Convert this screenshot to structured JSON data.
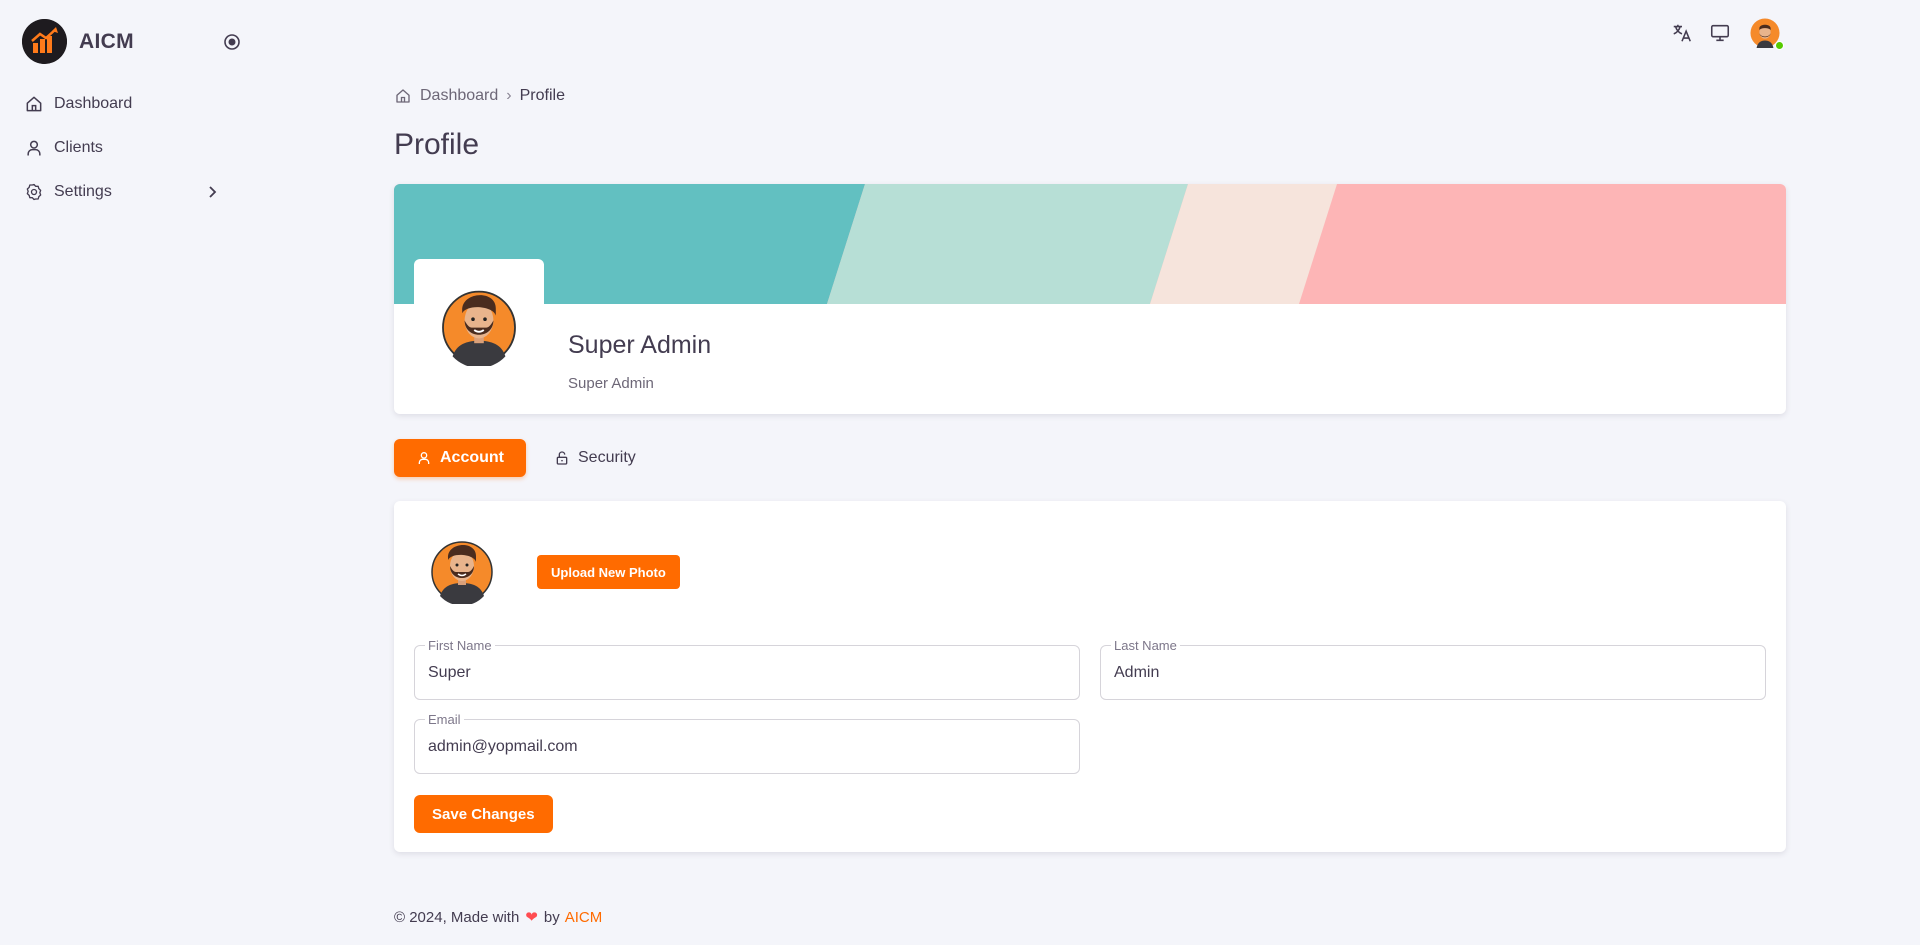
{
  "brand": {
    "name": "AICM"
  },
  "sidebar": {
    "items": [
      {
        "label": "Dashboard",
        "icon": "home-icon"
      },
      {
        "label": "Clients",
        "icon": "user-icon"
      },
      {
        "label": "Settings",
        "icon": "gear-icon",
        "has_submenu": true
      }
    ]
  },
  "topbar": {
    "icons": [
      "translate-icon",
      "monitor-icon",
      "avatar"
    ],
    "status": "online"
  },
  "breadcrumb": {
    "home": "Dashboard",
    "separator": "›",
    "current": "Profile"
  },
  "page": {
    "title": "Profile"
  },
  "profile": {
    "name": "Super Admin",
    "role": "Super Admin",
    "banner_colors": [
      "#62c0c1",
      "#b7dfd6",
      "#f6e4dc",
      "#fdb5b6"
    ]
  },
  "tabs": [
    {
      "label": "Account",
      "icon": "user-icon",
      "active": true
    },
    {
      "label": "Security",
      "icon": "lock-icon",
      "active": false
    }
  ],
  "account": {
    "upload_label": "Upload New Photo",
    "first_name": {
      "label": "First Name",
      "value": "Super"
    },
    "last_name": {
      "label": "Last Name",
      "value": "Admin"
    },
    "email": {
      "label": "Email",
      "value": "admin@yopmail.com"
    },
    "save_label": "Save Changes"
  },
  "footer": {
    "prefix": "© 2024, Made with",
    "heart": "❤",
    "by": "by",
    "brand": "AICM"
  },
  "colors": {
    "accent": "#ff6b00",
    "online": "#56ca00"
  }
}
